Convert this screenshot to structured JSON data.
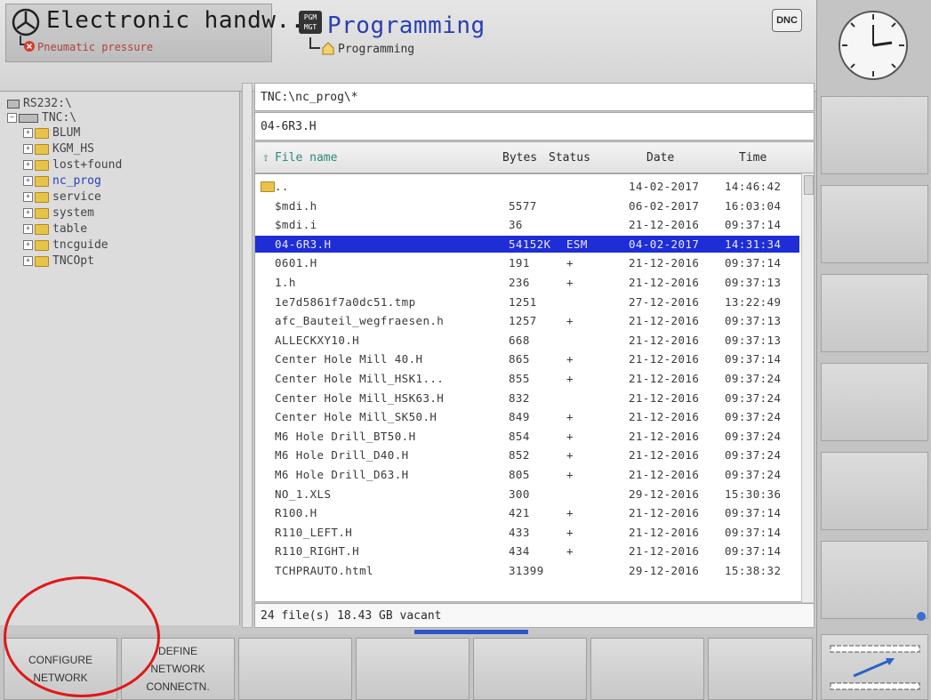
{
  "header": {
    "machine_mode_title": "Electronic handw...",
    "machine_mode_status": "Pneumatic pressure",
    "program_mode_title": "Programming",
    "program_mode_sub": "Programming",
    "dnc_label": "DNC"
  },
  "tree": {
    "root_rs232": "RS232:\\",
    "root_tnc": "TNC:\\",
    "folders": [
      "BLUM",
      "KGM_HS",
      "lost+found",
      "nc_prog",
      "service",
      "system",
      "table",
      "tncguide",
      "TNCOpt"
    ],
    "selected_folder": "nc_prog"
  },
  "files": {
    "path": "TNC:\\nc_prog\\*",
    "selected_file": "04-6R3.H",
    "columns": {
      "name": "File name",
      "bytes": "Bytes",
      "status": "Status",
      "date": "Date",
      "time": "Time"
    },
    "rows": [
      {
        "name": "..",
        "bytes": "",
        "status": "",
        "date": "14-02-2017",
        "time": "14:46:42",
        "folder": true
      },
      {
        "name": "$mdi.h",
        "bytes": "5577",
        "status": "",
        "date": "06-02-2017",
        "time": "16:03:04"
      },
      {
        "name": "$mdi.i",
        "bytes": "36",
        "status": "",
        "date": "21-12-2016",
        "time": "09:37:14"
      },
      {
        "name": "04-6R3.H",
        "bytes": "54152K",
        "status": "ESM",
        "date": "04-02-2017",
        "time": "14:31:34",
        "selected": true
      },
      {
        "name": "0601.H",
        "bytes": "191",
        "status": "+",
        "date": "21-12-2016",
        "time": "09:37:14"
      },
      {
        "name": "1.h",
        "bytes": "236",
        "status": "+",
        "date": "21-12-2016",
        "time": "09:37:13"
      },
      {
        "name": "1e7d5861f7a0dc51.tmp",
        "bytes": "1251",
        "status": "",
        "date": "27-12-2016",
        "time": "13:22:49"
      },
      {
        "name": "afc_Bauteil_wegfraesen.h",
        "bytes": "1257",
        "status": "+",
        "date": "21-12-2016",
        "time": "09:37:13"
      },
      {
        "name": "ALLECKXY10.H",
        "bytes": "668",
        "status": "",
        "date": "21-12-2016",
        "time": "09:37:13"
      },
      {
        "name": "Center Hole Mill 40.H",
        "bytes": "865",
        "status": "+",
        "date": "21-12-2016",
        "time": "09:37:14"
      },
      {
        "name": "Center Hole Mill_HSK1...",
        "bytes": "855",
        "status": "+",
        "date": "21-12-2016",
        "time": "09:37:24"
      },
      {
        "name": "Center Hole Mill_HSK63.H",
        "bytes": "832",
        "status": "",
        "date": "21-12-2016",
        "time": "09:37:24"
      },
      {
        "name": "Center Hole Mill_SK50.H",
        "bytes": "849",
        "status": "+",
        "date": "21-12-2016",
        "time": "09:37:24"
      },
      {
        "name": "M6 Hole Drill_BT50.H",
        "bytes": "854",
        "status": "+",
        "date": "21-12-2016",
        "time": "09:37:24"
      },
      {
        "name": "M6 Hole Drill_D40.H",
        "bytes": "852",
        "status": "+",
        "date": "21-12-2016",
        "time": "09:37:24"
      },
      {
        "name": "M6 Hole Drill_D63.H",
        "bytes": "805",
        "status": "+",
        "date": "21-12-2016",
        "time": "09:37:24"
      },
      {
        "name": "NO_1.XLS",
        "bytes": "300",
        "status": "",
        "date": "29-12-2016",
        "time": "15:30:36"
      },
      {
        "name": "R100.H",
        "bytes": "421",
        "status": "+",
        "date": "21-12-2016",
        "time": "09:37:14"
      },
      {
        "name": "R110_LEFT.H",
        "bytes": "433",
        "status": "+",
        "date": "21-12-2016",
        "time": "09:37:14"
      },
      {
        "name": "R110_RIGHT.H",
        "bytes": "434",
        "status": "+",
        "date": "21-12-2016",
        "time": "09:37:14"
      },
      {
        "name": "TCHPRAUTO.html",
        "bytes": "31399",
        "status": "",
        "date": "29-12-2016",
        "time": "15:38:32"
      }
    ],
    "status_text": "24  file(s)  18.43 GB vacant"
  },
  "softkeys": {
    "configure_network": [
      "CONFIGURE",
      "NETWORK"
    ],
    "define_network": [
      "DEFINE",
      "NETWORK",
      "CONNECTN."
    ]
  },
  "colors": {
    "selection": "#1e2dd6",
    "annotation_circle": "#e01818",
    "title_blue": "#2a3fb0"
  }
}
